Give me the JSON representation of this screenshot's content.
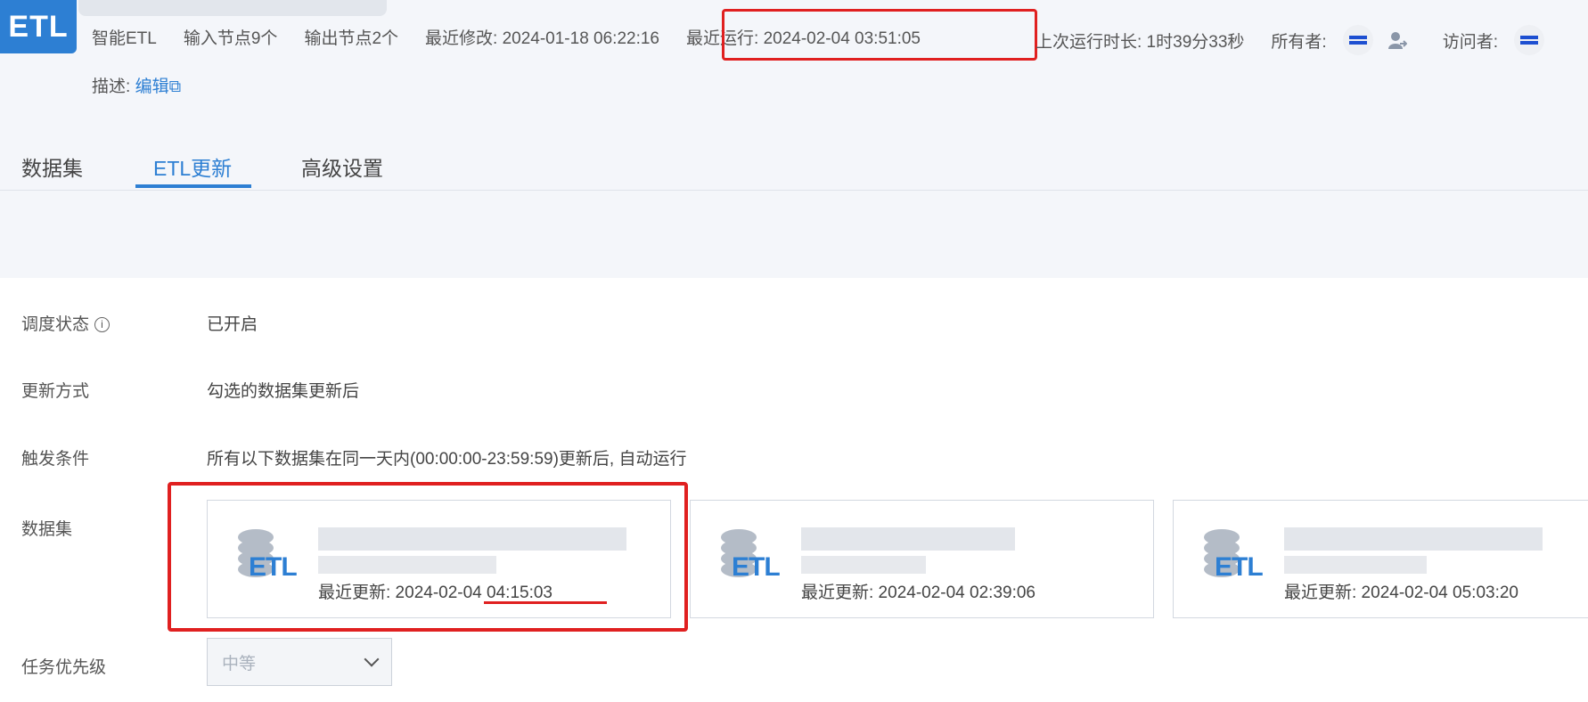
{
  "header": {
    "logo_text": "ETL",
    "type_label": "智能ETL",
    "input_nodes": "输入节点9个",
    "output_nodes": "输出节点2个",
    "last_modified": "最近修改: 2024-01-18 06:22:16",
    "last_run": "最近运行: 2024-02-04 03:51:05",
    "last_duration": "上次运行时长: 1时39分33秒",
    "owner_label": "所有者:",
    "visitor_label": "访问者:",
    "desc_label": "描述: ",
    "desc_edit": "编辑",
    "edit_icon": "edit-icon"
  },
  "tabs": [
    {
      "label": "数据集"
    },
    {
      "label": "ETL更新"
    },
    {
      "label": "高级设置"
    }
  ],
  "settings": {
    "schedule_label": "调度状态",
    "schedule_value": "已开启",
    "update_mode_label": "更新方式",
    "update_mode_value": "勾选的数据集更新后",
    "trigger_label": "触发条件",
    "trigger_value": "所有以下数据集在同一天内(00:00:00-23:59:59)更新后, 自动运行",
    "datasets_label": "数据集",
    "priority_label": "任务优先级",
    "priority_value": "中等"
  },
  "datasets": [
    {
      "icon_text": "ETL",
      "updated": "最近更新: 2024-02-04 04:15:03"
    },
    {
      "icon_text": "ETL",
      "updated": "最近更新: 2024-02-04 02:39:06"
    },
    {
      "icon_text": "ETL",
      "updated": "最近更新: 2024-02-04 05:03:20"
    }
  ],
  "colors": {
    "accent": "#2d7fd3",
    "highlight": "#e02020"
  }
}
